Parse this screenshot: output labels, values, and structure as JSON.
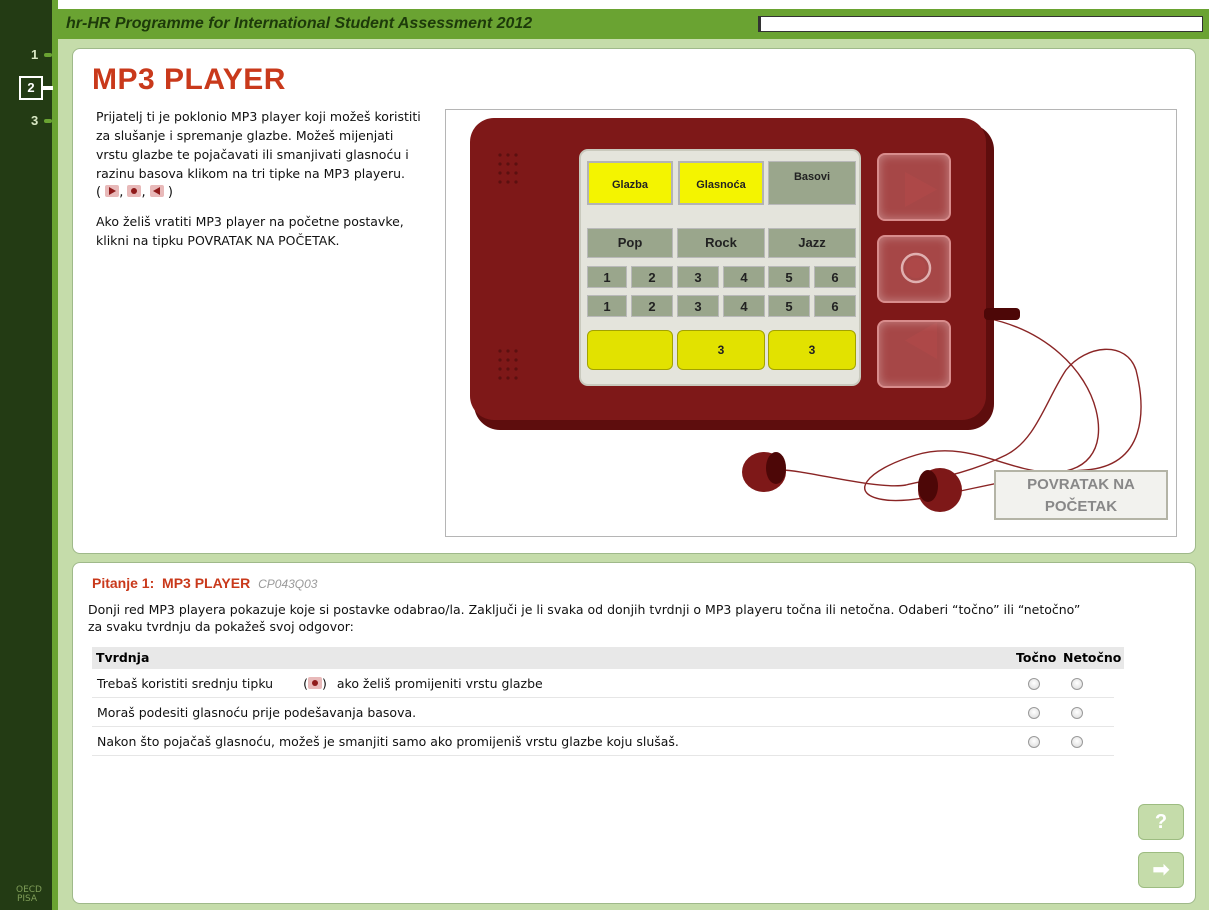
{
  "header": {
    "title": "hr-HR Programme for International Student Assessment 2012"
  },
  "nav": {
    "units": [
      "1",
      "2",
      "3"
    ]
  },
  "footer_logo": "OECD PISA",
  "stimulus": {
    "title": "MP3 PLAYER",
    "paragraph1": "Prijatelj ti je poklonio MP3 player koji možeš koristiti za slušanje i spremanje glazbe. Možeš mijenjati vrstu glazbe te pojačavati ili smanjivati glasnoću i razinu basova klikom na tri tipke na MP3 playeru.",
    "paragraph2": "Ako želiš vratiti MP3 player na početne postavke, klikni na tipku POVRATAK NA POČETAK.",
    "reset_button": "POVRATAK NA POČETAK",
    "screen": {
      "headers": [
        "Glazba",
        "Glasnoća",
        "Basovi"
      ],
      "genres": [
        "Pop",
        "Rock",
        "Jazz"
      ],
      "numbers": [
        "1",
        "2",
        "3",
        "4",
        "5",
        "6"
      ],
      "bottom_values": [
        "",
        "3",
        "3"
      ]
    }
  },
  "question": {
    "label": "Pitanje 1:",
    "unit": "MP3 PLAYER",
    "code": "CP043Q03",
    "text": "Donji red MP3 playera pokazuje koje si postavke odabrao/la. Zaključi je li svaka od donjih tvrdnji o MP3 playeru točna ili netočna. Odaberi “točno” ili “netočno” za svaku tvrdnju da pokažeš svoj odgovor:",
    "col_statement": "Tvrdnja",
    "col_true": "Točno",
    "col_false": "Netočno",
    "rows": [
      {
        "before": "Trebaš koristiti srednju tipku",
        "after": "ako želiš promijeniti vrstu glazbe"
      },
      {
        "before": "Moraš podesiti glasnoću prije podešavanja basova.",
        "after": ""
      },
      {
        "before": "Nakon što pojačaš glasnoću, možeš je smanjiti samo ako promijeniš vrstu glazbe koju slušaš.",
        "after": ""
      }
    ]
  },
  "controls": {
    "help": "?",
    "next": "➡"
  }
}
